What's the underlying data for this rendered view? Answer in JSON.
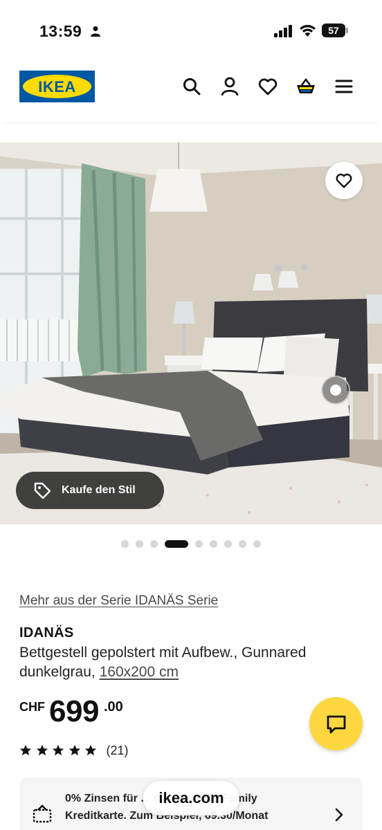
{
  "status_bar": {
    "time": "13:59",
    "battery": "57"
  },
  "header": {
    "logo": "IKEA",
    "icons": [
      "search-icon",
      "account-icon",
      "heart-icon",
      "cart-icon",
      "menu-icon"
    ]
  },
  "gallery": {
    "shop_style_label": "Kaufe den Stil",
    "dots_total": 9,
    "active_dot": 4
  },
  "product": {
    "series_link": "Mehr aus der Serie IDANÄS Serie",
    "name": "IDANÄS",
    "description": "Bettgestell gepolstert mit Aufbew., Gunnared dunkelgrau, ",
    "size": "160x200 cm",
    "currency": "CHF",
    "price_main": "699",
    "price_decimals": ".00",
    "rating": 5,
    "review_count": "(21)"
  },
  "finance": {
    "text": "0% Zinsen für ... mit der IKEA Family Kreditkarte. Zum Beispiel, 69.30/Monat"
  },
  "browser": {
    "url": "ikea.com"
  },
  "colors": {
    "ikea_blue": "#0058a3",
    "ikea_yellow": "#ffdb00",
    "chat_yellow": "#fcd740"
  }
}
